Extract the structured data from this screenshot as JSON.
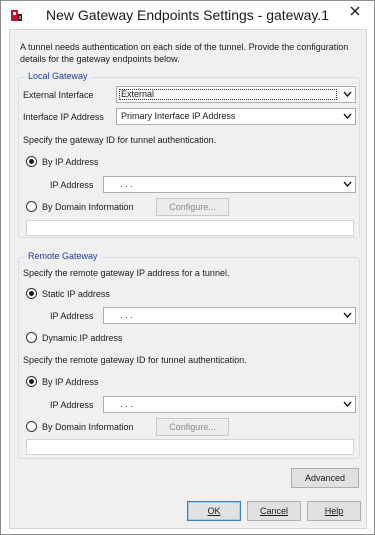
{
  "window": {
    "title": "New Gateway Endpoints Settings - gateway.1",
    "icon": "firebox-app-icon",
    "close_icon": "close-icon"
  },
  "intro": "A tunnel needs authentication on each side of the tunnel. Provide the configuration details for the gateway endpoints below.",
  "local": {
    "legend": "Local Gateway",
    "external_interface_label": "External Interface",
    "external_interface_value": "External",
    "interface_ip_label": "Interface IP Address",
    "interface_ip_value": "Primary Interface IP Address",
    "gateway_id_prompt": "Specify the gateway ID for tunnel authentication.",
    "by_ip_label": "By IP Address",
    "by_ip_selected": true,
    "ip_address_label": "IP Address",
    "ip_address_value": ".   .   .",
    "by_domain_label": "By Domain Information",
    "configure_label": "Configure..."
  },
  "remote": {
    "legend": "Remote Gateway",
    "ip_prompt": "Specify the remote gateway IP address for a tunnel.",
    "static_ip_label": "Static IP address",
    "static_selected": true,
    "ip_address_label": "IP Address",
    "ip_address_value": ".   .   .",
    "dynamic_ip_label": "Dynamic IP address",
    "gateway_id_prompt": "Specify the remote gateway ID for tunnel authentication.",
    "by_ip_label": "By IP Address",
    "by_ip_selected": true,
    "ip_address_label_2": "IP Address",
    "ip_address_value_2": ".   .   .",
    "by_domain_label": "By Domain Information",
    "configure_label": "Configure..."
  },
  "buttons": {
    "advanced": "Advanced",
    "ok": "OK",
    "cancel": "Cancel",
    "help": "Help"
  },
  "colors": {
    "legend": "#1f3c9a",
    "default_button_border": "#3c7fb1"
  }
}
